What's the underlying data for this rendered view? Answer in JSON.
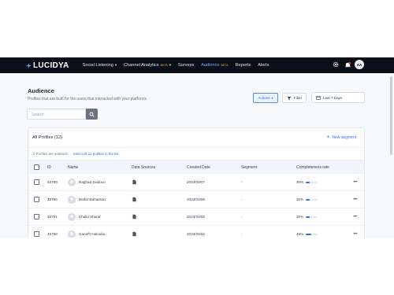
{
  "nav": {
    "brand": "LUCIDYA",
    "items": [
      {
        "label": "Social Listening",
        "has_caret": true,
        "beta": "",
        "active": false
      },
      {
        "label": "Channel Analytics",
        "has_caret": true,
        "beta": "BETA",
        "active": false
      },
      {
        "label": "Surveys",
        "has_caret": false,
        "beta": "",
        "active": false
      },
      {
        "label": "Audience",
        "has_caret": false,
        "beta": "BETA",
        "active": true
      },
      {
        "label": "Reports",
        "has_caret": false,
        "beta": "",
        "active": false
      },
      {
        "label": "Alerts",
        "has_caret": false,
        "beta": "",
        "active": false
      }
    ],
    "avatar_initials": "AA"
  },
  "page": {
    "title": "Audience",
    "subtitle": "Profiles that are built for the users that interacted with your platforms",
    "search_placeholder": "Search",
    "actions_label": "Actions",
    "filter_label": "Filter",
    "date_range_label": "Last 7 Days"
  },
  "profiles": {
    "title": "All Profiles (12)",
    "new_segment_label": "New segment",
    "selection_text": "0 Profiles are selected.",
    "select_all_link": "Select all 12 profiles in the list",
    "columns": {
      "id": "ID",
      "name": "Name",
      "sources": "Data Sources",
      "created": "Created Date",
      "segment": "Segment",
      "completeness": "Completeness rate"
    },
    "rows": [
      {
        "id": "45799",
        "name": "Raghad Zaidoun",
        "created": "2023/03/07",
        "segment": "-",
        "completeness": "30%",
        "fill": 0.3
      },
      {
        "id": "45796",
        "name": "Bedar Bahassan",
        "created": "2023/03/06",
        "segment": "-",
        "completeness": "30%",
        "fill": 0.3
      },
      {
        "id": "45791",
        "name": "Khalid Sharaf",
        "created": "2023/03/05",
        "segment": "-",
        "completeness": "30%",
        "fill": 0.3
      },
      {
        "id": "45788",
        "name": "Ganofh Halouka",
        "created": "2023/03/02",
        "segment": "-",
        "completeness": "45%",
        "fill": 0.45
      }
    ]
  },
  "colors": {
    "nav_bg": "#0b0f1a",
    "accent": "#2f6fe4",
    "beta": "#f2a73b",
    "notification": "#e0343b"
  }
}
